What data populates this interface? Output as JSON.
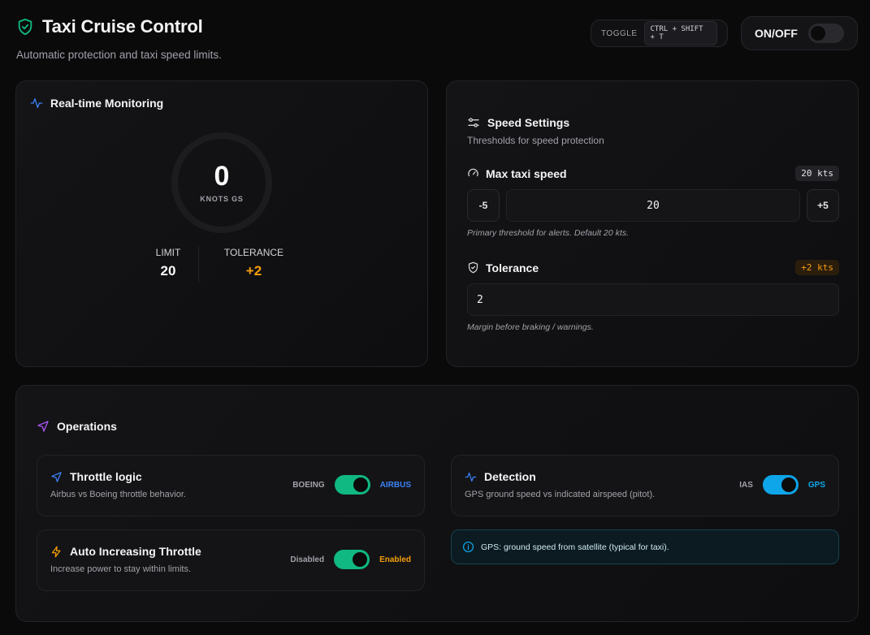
{
  "header": {
    "title": "Taxi Cruise Control",
    "subtitle": "Automatic protection and taxi speed limits.",
    "toggle_label": "TOGGLE",
    "shortcut": "CTRL + SHIFT + T",
    "onoff_label": "ON/OFF",
    "onoff_state": false
  },
  "monitoring": {
    "title": "Real-time Monitoring",
    "speed_value": "0",
    "speed_unit": "KNOTS GS",
    "limit_label": "LIMIT",
    "limit_value": "20",
    "tolerance_label": "TOLERANCE",
    "tolerance_value": "+2"
  },
  "speed_settings": {
    "title": "Speed Settings",
    "description": "Thresholds for speed protection",
    "max_speed": {
      "label": "Max taxi speed",
      "badge": "20 kts",
      "decrement": "-5",
      "value": "20",
      "increment": "+5",
      "hint": "Primary threshold for alerts. Default 20 kts."
    },
    "tolerance": {
      "label": "Tolerance",
      "badge": "+2 kts",
      "value": "2",
      "hint": "Margin before braking / warnings."
    }
  },
  "operations": {
    "title": "Operations",
    "throttle_logic": {
      "title": "Throttle logic",
      "description": "Airbus vs Boeing throttle behavior.",
      "left_label": "BOEING",
      "right_label": "AIRBUS",
      "state": "on",
      "accent": "#3b82f6"
    },
    "detection": {
      "title": "Detection",
      "description": "GPS ground speed vs indicated airspeed (pitot).",
      "left_label": "IAS",
      "right_label": "GPS",
      "state": "on",
      "accent": "#0ea5e9"
    },
    "auto_throttle": {
      "title": "Auto Increasing Throttle",
      "description": "Increase power to stay within limits.",
      "left_label": "Disabled",
      "right_label": "Enabled",
      "state": "on",
      "accent": "#f59e0b"
    },
    "info": "GPS: ground speed from satellite (typical for taxi)."
  },
  "colors": {
    "background": "#0a0a0b",
    "green": "#10b981",
    "blue": "#3b82f6",
    "cyan": "#0ea5e9",
    "amber": "#f59e0b",
    "purple": "#a855f7"
  }
}
